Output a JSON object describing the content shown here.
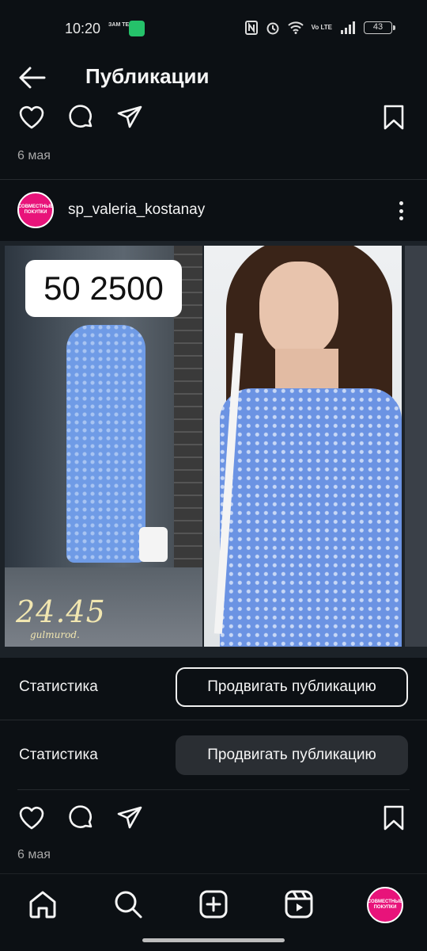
{
  "status_bar": {
    "time": "10:20",
    "temu_label": "ЗАМ ТEMU",
    "volte": "Vo LTE",
    "battery": "43"
  },
  "header": {
    "title": "Публикации"
  },
  "previous_post": {
    "date": "6 мая"
  },
  "post": {
    "username": "sp_valeria_kostanay",
    "avatar_text": "СОВМЕСТНЫЕ ПОКУПКИ",
    "price": "50 2500",
    "watermark": "24.45",
    "watermark_sub": "gulmurod.",
    "date": "6 мая"
  },
  "stats_rows": [
    {
      "label": "Статистика",
      "button": "Продвигать публикацию"
    },
    {
      "label": "Статистика",
      "button": "Продвигать публикацию"
    }
  ],
  "bottom_nav": {
    "profile_avatar_text": "СОВМЕСТНЫЕ ПОКУПКИ"
  },
  "colors": {
    "background": "#0c1014",
    "text": "#f5f5f5",
    "muted": "#a8a8a8",
    "avatar": "#e8137a",
    "button_filled": "#2a2e33"
  }
}
